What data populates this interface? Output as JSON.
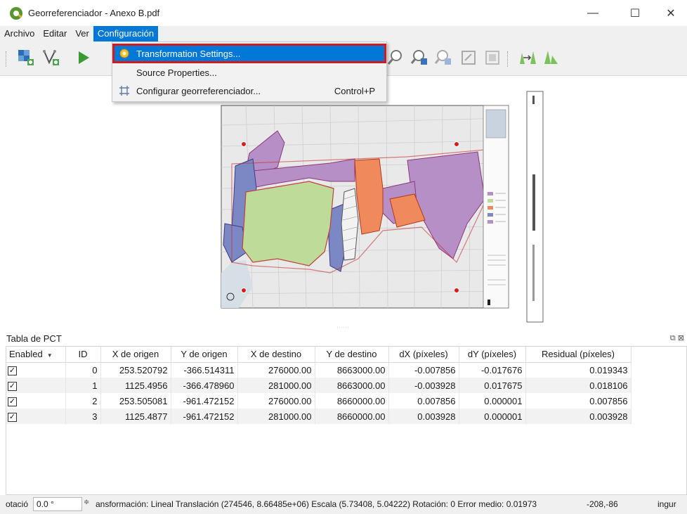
{
  "window": {
    "title": "Georreferenciador - Anexo B.pdf",
    "minimize": "—",
    "maximize": "☐",
    "close": "✕"
  },
  "menubar": {
    "items": [
      "Archivo",
      "Editar",
      "Ver",
      "Configuración"
    ],
    "active": "Configuración"
  },
  "dropdown": {
    "items": [
      {
        "label": "Transformation Settings...",
        "icon": "gear-icon",
        "shortcut": ""
      },
      {
        "label": "Source Properties...",
        "icon": "",
        "shortcut": ""
      },
      {
        "label": "Configurar georreferenciador...",
        "icon": "grid-icon",
        "shortcut": "Control+P"
      }
    ]
  },
  "panel": {
    "title": "Tabla de PCT",
    "columns": [
      "Enabled",
      "ID",
      "X de origen",
      "Y de origen",
      "X de destino",
      "Y de destino",
      "dX (píxeles)",
      "dY (píxeles)",
      "Residual (píxeles)"
    ],
    "rows": [
      {
        "enabled": "✓",
        "id": "0",
        "x_origen": "253.520792",
        "y_origen": "-366.514311",
        "x_destino": "276000.00",
        "y_destino": "8663000.00",
        "dx": "-0.007856",
        "dy": "-0.017676",
        "residual": "0.019343"
      },
      {
        "enabled": "✓",
        "id": "1",
        "x_origen": "1125.4956",
        "y_origen": "-366.478960",
        "x_destino": "281000.00",
        "y_destino": "8663000.00",
        "dx": "-0.003928",
        "dy": "0.017675",
        "residual": "0.018106"
      },
      {
        "enabled": "✓",
        "id": "2",
        "x_origen": "253.505081",
        "y_origen": "-961.472152",
        "x_destino": "276000.00",
        "y_destino": "8660000.00",
        "dx": "0.007856",
        "dy": "0.000001",
        "residual": "0.007856"
      },
      {
        "enabled": "✓",
        "id": "3",
        "x_origen": "1125.4877",
        "y_origen": "-961.472152",
        "x_destino": "281000.00",
        "y_destino": "8660000.00",
        "dx": "0.003928",
        "dy": "0.000001",
        "residual": "0.003928"
      }
    ]
  },
  "statusbar": {
    "rotation_label": "otació",
    "rotation_value": "0.0 °",
    "transform_text": "ansformación: Lineal Translación (274546, 8.66485e+06) Escala (5.73408, 5.04222) Rotación: 0 Error medio: 0.01973",
    "coords": "-208,-86",
    "trailing": "ingur"
  },
  "colors": {
    "accent": "#0078d7",
    "highlight_border": "#d01c1c",
    "map_purple": "#b58fc6",
    "map_green": "#bedb9a",
    "map_orange": "#f08a5d",
    "map_blue": "#7c88c4",
    "gcp_point": "#d81e1e"
  }
}
